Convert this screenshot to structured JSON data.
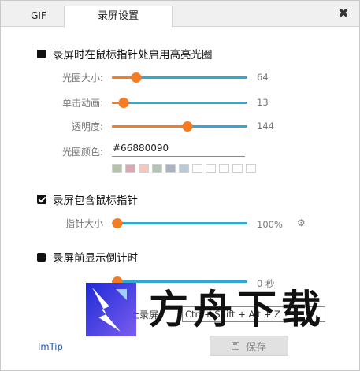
{
  "tabs": [
    {
      "label": "GIF",
      "active": false
    },
    {
      "label": "录屏设置",
      "active": true
    }
  ],
  "close_label": "✖",
  "highlight": {
    "section_label": "录屏时在鼠标指针处启用高亮光圈",
    "enabled": true,
    "rows": [
      {
        "label": "光圈大小:",
        "value": "64",
        "level": 0.18
      },
      {
        "label": "单击动画:",
        "value": "13",
        "level": 0.09
      },
      {
        "label": "透明度:",
        "value": "144",
        "level": 0.56
      }
    ],
    "color_label": "光圈颜色:",
    "color_value": "#66880090",
    "swatches": [
      "#b5c4a8",
      "#d9a9b3",
      "#f5c8bb",
      "#b3c4b7",
      "#a8b4c4",
      "#b9cad6",
      "#ffffff",
      "#ffffff",
      "#ffffff",
      "#ffffff",
      "#ffffff"
    ]
  },
  "cursor": {
    "section_label": "录屏包含鼠标指针",
    "checked": true,
    "size_label": "指针大小",
    "size_value": "100%",
    "level": 0.04,
    "gear_icon": "gear-icon"
  },
  "countdown": {
    "section_label": "录屏前显示倒计时",
    "enabled": true,
    "value": "0 秒",
    "level": 0.04
  },
  "hotkey": {
    "label": "停止录屏",
    "value": "Ctrl + Shift + Alt + Z"
  },
  "footer": {
    "link": "ImTip",
    "save_label": "保存"
  },
  "watermark": {
    "text": "方舟下载"
  },
  "colors": {
    "accent": "#f57c22",
    "track": "#2ea9d6"
  }
}
